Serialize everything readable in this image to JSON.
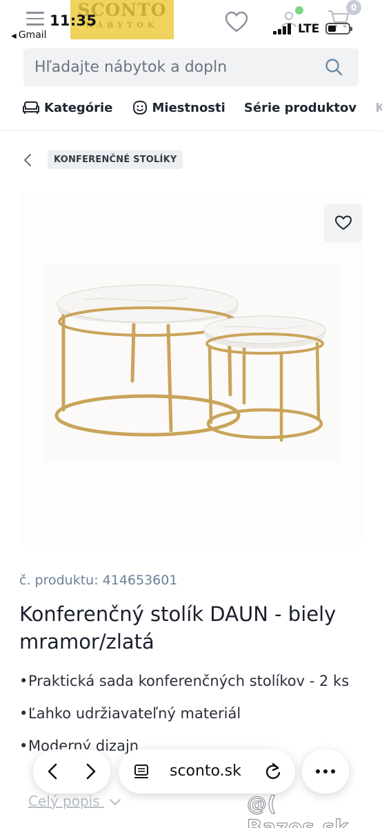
{
  "status_bar": {
    "time": "11:35",
    "back_app": "Gmail",
    "network": "LTE"
  },
  "header": {
    "logo_main": "SCONTO",
    "logo_sub": "NÁBYTOK",
    "cart_count": "0"
  },
  "search": {
    "placeholder": "Hľadajte nábytok a dopln"
  },
  "category_nav": {
    "items": [
      {
        "label": "Kategórie",
        "icon": "sofa-icon"
      },
      {
        "label": "Miestnosti",
        "icon": "smile-icon"
      },
      {
        "label": "Série produktov"
      },
      {
        "label": "Ku"
      }
    ]
  },
  "breadcrumb": {
    "label": "KONFERENČNÉ STOLÍKY"
  },
  "product": {
    "sku": "č. produktu: 414653601",
    "title": "Konferenčný stolík DAUN - biely mramor/zlatá",
    "bullets": [
      "Praktická sada konferenčných stolíkov - 2 ks",
      "Ľahko udržiavateľný materiál",
      "Moderný dizajn"
    ],
    "description_link": "Celý popis"
  },
  "browser": {
    "address": "sconto.sk"
  },
  "watermark": "@( Bazos.sk",
  "colors": {
    "logo_bg": "#efd35c",
    "search_bg": "#f1f2f4",
    "sku": "#6b8196",
    "table_gold": "#c9a45a"
  }
}
